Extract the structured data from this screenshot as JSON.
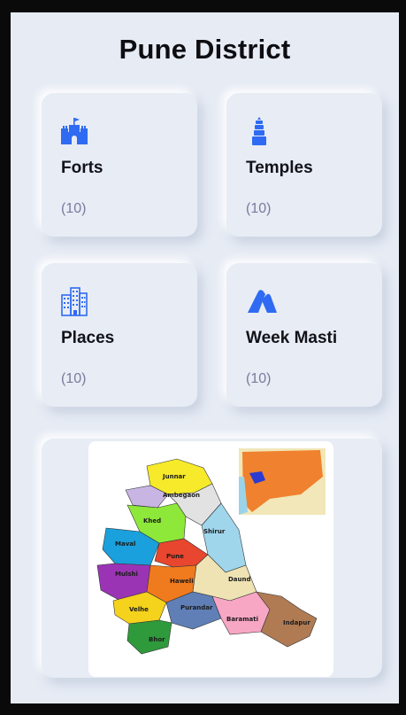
{
  "page": {
    "title": "Pune District"
  },
  "cards": [
    {
      "id": "forts",
      "label": "Forts",
      "count": "(10)",
      "icon": "fort-icon"
    },
    {
      "id": "temples",
      "label": "Temples",
      "count": "(10)",
      "icon": "temple-icon"
    },
    {
      "id": "places",
      "label": "Places",
      "count": "(10)",
      "icon": "buildings-icon"
    },
    {
      "id": "week",
      "label": "Week Masti",
      "count": "(10)",
      "icon": "mountain-icon"
    }
  ],
  "map": {
    "regions": [
      "Junnar",
      "Ambegaon",
      "Khed",
      "Shirur",
      "Maval",
      "Pune",
      "Mulshi",
      "Haweli",
      "Daund",
      "Velhe",
      "Purandar",
      "Baramati",
      "Indapur",
      "Bhor"
    ]
  },
  "colors": {
    "accent": "#2f6bf2",
    "background": "#e6ebf4",
    "count_text": "#7c7a9c"
  }
}
